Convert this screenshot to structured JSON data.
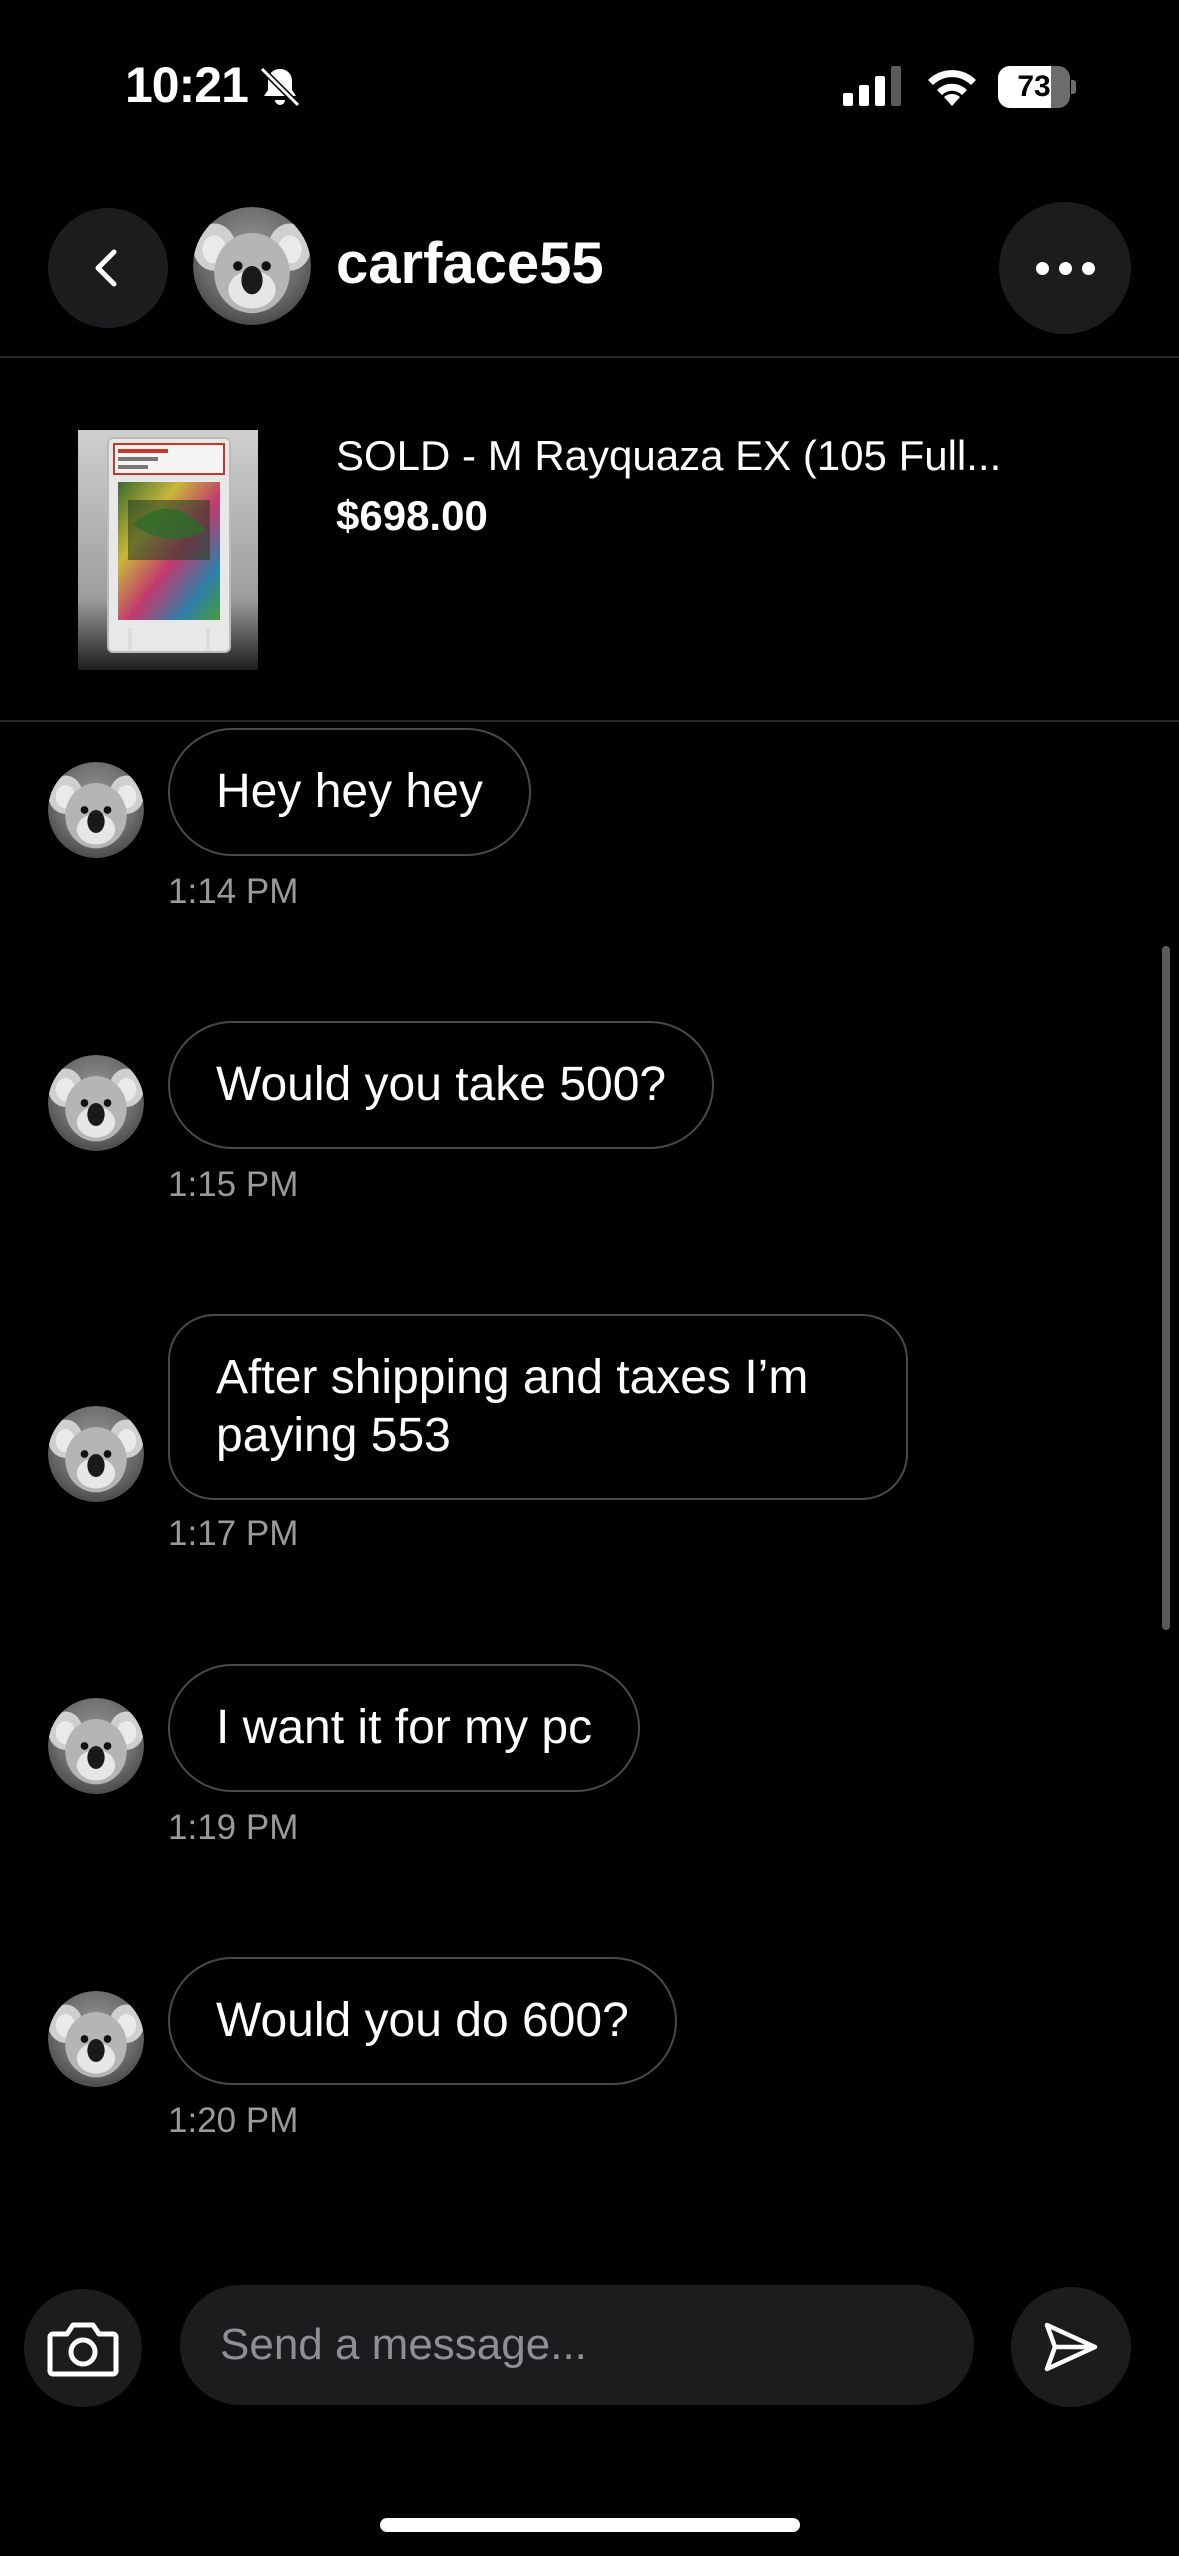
{
  "status_bar": {
    "time": "10:21",
    "battery_level": "73",
    "battery_fraction": 0.73
  },
  "header": {
    "username": "carface55",
    "back_icon": "chevron-left-icon",
    "more_icon": "ellipsis-icon"
  },
  "listing": {
    "title": "SOLD - M Rayquaza EX (105 Full...",
    "price": "$698.00"
  },
  "messages": [
    {
      "text": "Hey hey hey",
      "time": "1:14 PM"
    },
    {
      "text": "Would you take 500?",
      "time": "1:15 PM"
    },
    {
      "text": "After shipping and taxes I’m paying 553",
      "time": "1:17 PM"
    },
    {
      "text": "I want it for my pc",
      "time": "1:19 PM"
    },
    {
      "text": "Would you do 600?",
      "time": "1:20 PM"
    }
  ],
  "compose": {
    "placeholder": "Send a message...",
    "camera_icon": "camera-icon",
    "send_icon": "send-icon"
  },
  "colors": {
    "background": "#000000",
    "surface": "#1c1c1e",
    "bubble_border": "#4a4a4a",
    "timestamp": "#9a9a9a"
  }
}
